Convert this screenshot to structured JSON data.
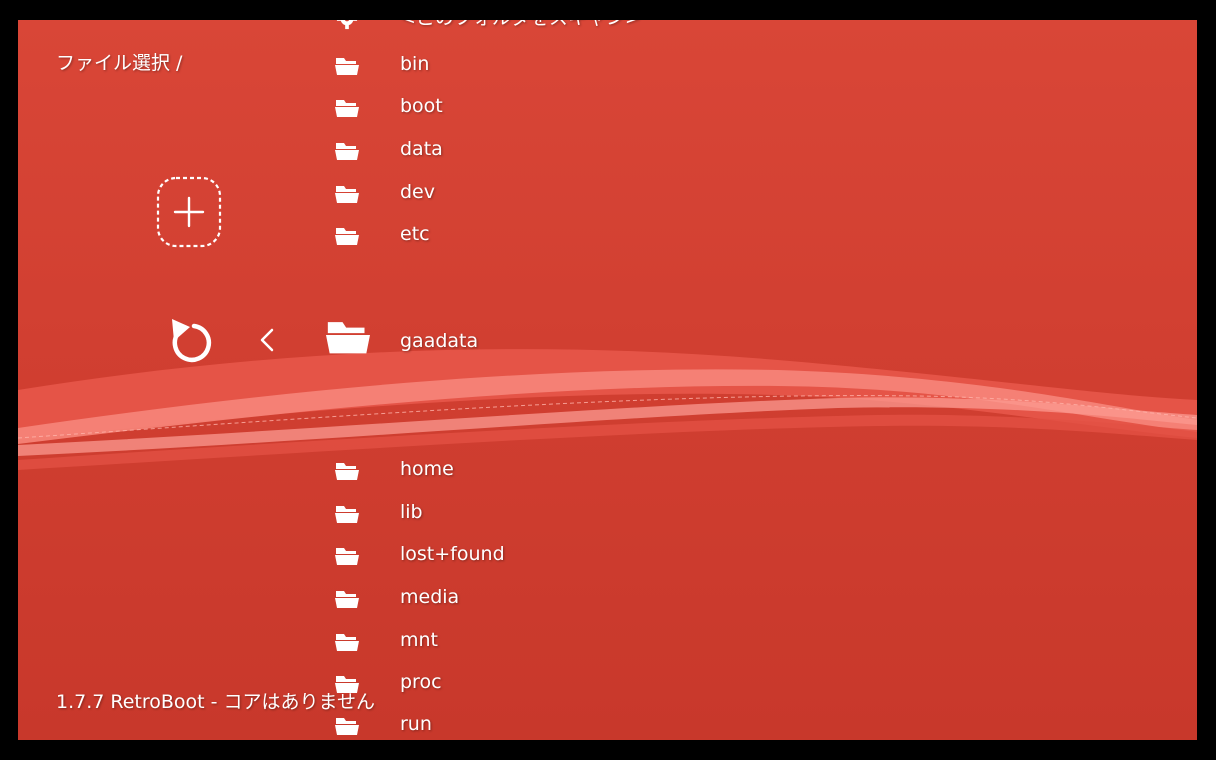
{
  "header": {
    "title": "ファイル選択 /"
  },
  "footer": {
    "version_text": "1.7.7 RetroBoot - コアはありません"
  },
  "actions": {
    "add_icon": "plus-dashed-icon",
    "back_icon": "undo-arrow-icon",
    "nav_icon": "chevron-left-icon"
  },
  "file_list": {
    "scan_item": {
      "label": "<このフォルダをスキャン>",
      "icon": "gear-icon"
    },
    "items": [
      {
        "label": "bin",
        "icon": "folder-icon"
      },
      {
        "label": "boot",
        "icon": "folder-icon"
      },
      {
        "label": "data",
        "icon": "folder-icon"
      },
      {
        "label": "dev",
        "icon": "folder-icon"
      },
      {
        "label": "etc",
        "icon": "folder-icon"
      },
      {
        "label": "gaadata",
        "icon": "folder-icon",
        "selected": true
      },
      {
        "label": "home",
        "icon": "folder-icon"
      },
      {
        "label": "lib",
        "icon": "folder-icon"
      },
      {
        "label": "lost+found",
        "icon": "folder-icon"
      },
      {
        "label": "media",
        "icon": "folder-icon"
      },
      {
        "label": "mnt",
        "icon": "folder-icon"
      },
      {
        "label": "proc",
        "icon": "folder-icon"
      },
      {
        "label": "run",
        "icon": "folder-icon"
      }
    ]
  },
  "colors": {
    "background_top": "#d94637",
    "background_bottom": "#c8382b",
    "text": "#ffffff",
    "wave": "#f6857a"
  }
}
